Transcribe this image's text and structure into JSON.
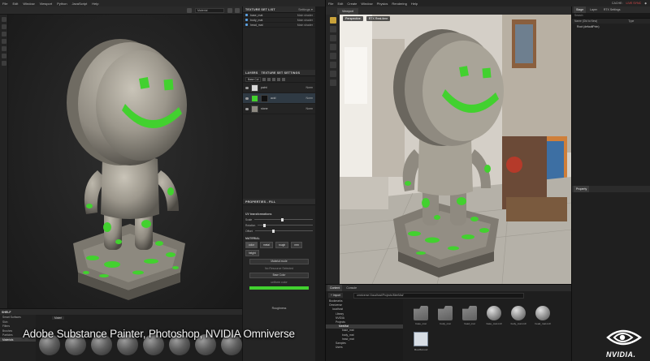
{
  "substance_painter": {
    "menu": [
      "File",
      "Edit",
      "Window",
      "Viewport",
      "Python",
      "JavaScript",
      "Help"
    ],
    "mode_select": "Material",
    "texture_set_list": {
      "title": "TEXTURE SET LIST",
      "settings_label": "Settings ▾",
      "items": [
        {
          "name": "base_mat",
          "shader": "Main shader"
        },
        {
          "name": "body_mat",
          "shader": "Main shader"
        },
        {
          "name": "head_mat",
          "shader": "Main shader"
        }
      ]
    },
    "layers": {
      "tabs": [
        "LAYERS",
        "TEXTURE SET SETTINGS"
      ],
      "channel_select": "Base Col",
      "items": [
        {
          "name": "paint",
          "mode": "Norm",
          "opacity": "100"
        },
        {
          "name": "acid",
          "mode": "Norm",
          "opacity": "100"
        },
        {
          "name": "stone",
          "mode": "Norm",
          "opacity": "100"
        }
      ]
    },
    "properties": {
      "title": "PROPERTIES - FILL",
      "section": "UV transformations",
      "scale_label": "Scale",
      "rotation_label": "Rotation",
      "offset_label": "Offset",
      "material_label": "MATERIAL",
      "channels": [
        "color",
        "metal",
        "rough",
        "nrm",
        "height"
      ],
      "material_mode_label": "Material mode",
      "material_mode_value": "No Resource Selected",
      "base_color_label": "Base Color",
      "base_color_value": "uniform color",
      "roughness_label": "Roughness"
    },
    "shelf": {
      "title": "SHELF",
      "categories": [
        "Smart Surfaces",
        "Skin",
        "Filters",
        "Brushes",
        "Particles",
        "Materials"
      ],
      "selected_category": "Materials",
      "filter_label": "Materi"
    }
  },
  "omniverse": {
    "menu": [
      "File",
      "Edit",
      "Create",
      "Window",
      "Physics",
      "Rendering",
      "Help"
    ],
    "status": {
      "cache": "CACHE:",
      "live": "LIVE SYNC",
      "extra": "◆"
    },
    "viewport_tab": "Viewport",
    "viewport_bar": [
      "Perspective",
      "RTX Real-time"
    ],
    "stage": {
      "tabs": [
        "Stage",
        "Layer",
        "RTX Settings"
      ],
      "search_placeholder": "Search",
      "columns": [
        "Name (Old to New)",
        "Type"
      ],
      "root": "Root (defaultPrim)"
    },
    "property_title": "Property",
    "content": {
      "tabs": [
        "Content",
        "Console"
      ],
      "import_label": "+ Import",
      "path": "omniverse://localhost/Projects/MeeMat/",
      "tree": [
        "Bookmarks",
        "Omniverse",
        "localhost",
        "Library",
        "NVIDIA",
        "Projects",
        "MeeMat",
        "base_mat",
        "body_mat",
        "head_mat",
        "Samples",
        "Users"
      ],
      "tree_selected": "MeeMat",
      "assets": [
        {
          "label": "base_mat",
          "kind": "folder"
        },
        {
          "label": "body_mat",
          "kind": "folder"
        },
        {
          "label": "head_mat",
          "kind": "folder"
        },
        {
          "label": "base_mat.mdl",
          "kind": "sphere"
        },
        {
          "label": "body_mat.mdl",
          "kind": "sphere"
        },
        {
          "label": "head_mat.mdl",
          "kind": "sphere"
        },
        {
          "label": "MeeMat.usd",
          "kind": "file"
        }
      ]
    }
  },
  "caption": "Adobe Substance Painter, Photoshop, NVIDIA Omniverse",
  "logo_text": "NVIDIA.",
  "colors": {
    "acid_green": "#42d12f",
    "nvidia_green": "#76b900"
  }
}
